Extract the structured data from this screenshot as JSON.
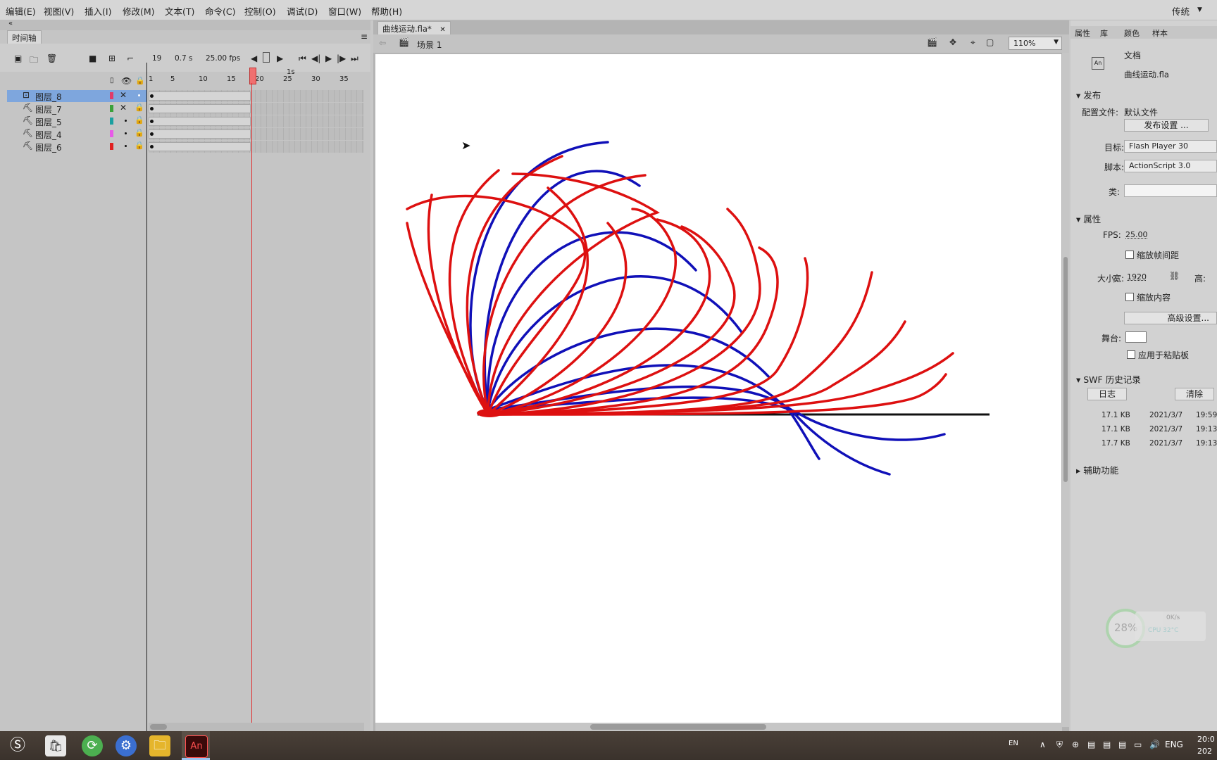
{
  "menu": [
    "编辑(E)",
    "视图(V)",
    "插入(I)",
    "修改(M)",
    "文本(T)",
    "命令(C)",
    "控制(O)",
    "调试(D)",
    "窗口(W)",
    "帮助(H)"
  ],
  "workspace": "传统",
  "timeline": {
    "tab": "时间轴",
    "frame_number": "19",
    "time": "0.7 s",
    "fps": "25.00 fps",
    "ruler_labels": [
      "1",
      "5",
      "10",
      "15",
      "20",
      "25",
      "30",
      "35"
    ],
    "ruler_second": "1s",
    "layers": [
      {
        "name": "图层_8",
        "color": "#e03c6a",
        "selected": true
      },
      {
        "name": "图层_7",
        "color": "#3aa13a",
        "selected": false
      },
      {
        "name": "图层_5",
        "color": "#1aa0a0",
        "selected": false
      },
      {
        "name": "图层_4",
        "color": "#e85ae8",
        "selected": false
      },
      {
        "name": "图层_6",
        "color": "#e02020",
        "selected": false
      }
    ]
  },
  "document": {
    "tab": "曲线运动.fla*",
    "scene": "场景 1",
    "zoom": "110%"
  },
  "props": {
    "tabs": [
      "属性",
      "库",
      "颜色",
      "样本"
    ],
    "doc_label": "文档",
    "filename": "曲线运动.fla",
    "publish_header": "发布",
    "profile_label": "配置文件:",
    "profile_value": "默认文件",
    "publish_settings": "发布设置 ...",
    "target_label": "目标:",
    "target_value": "Flash Player 30",
    "script_label": "脚本:",
    "script_value": "ActionScript 3.0",
    "class_label": "类:",
    "properties_header": "属性",
    "fps_label": "FPS:",
    "fps_value": "25.00",
    "scale_spans": "缩放帧间距",
    "size_label": "大小:",
    "width_label": "宽:",
    "width_value": "1920",
    "height_label": "高:",
    "scale_content": "缩放内容",
    "advanced": "高级设置...",
    "stage_label": "舞台:",
    "stage_color": "#ffffff",
    "apply_pasteboard": "应用于粘贴板",
    "swf_header": "SWF 历史记录",
    "log_btn": "日志",
    "clear_btn": "清除",
    "history": [
      {
        "size": "17.1 KB",
        "date": "2021/3/7",
        "time": "19:59"
      },
      {
        "size": "17.1 KB",
        "date": "2021/3/7",
        "time": "19:13"
      },
      {
        "size": "17.7 KB",
        "date": "2021/3/7",
        "time": "19:13"
      }
    ],
    "accessibility_header": "辅助功能",
    "cpu_percent": "28%",
    "net_speed": "0K/s",
    "cpu_temp": "CPU 32°C"
  },
  "taskbar": {
    "lang_short": "EN",
    "lang": "ENG",
    "clock_time": "20:0",
    "clock_date": "202"
  },
  "colors": {
    "red_curve": "#dd1010",
    "blue_curve": "#1010b8"
  }
}
